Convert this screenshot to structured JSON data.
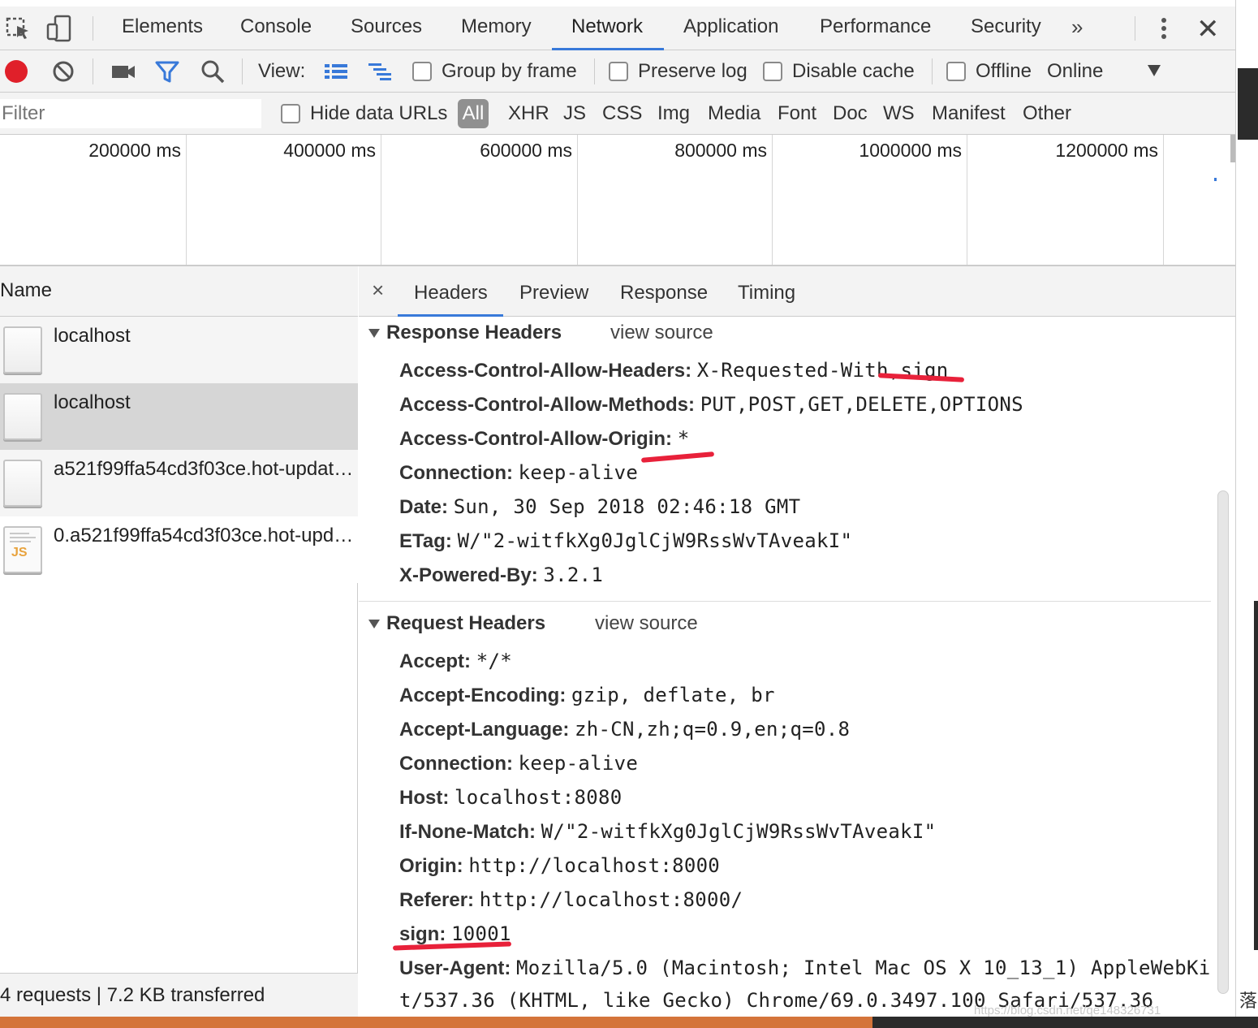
{
  "tabs": [
    "Elements",
    "Console",
    "Sources",
    "Memory",
    "Network",
    "Application",
    "Performance",
    "Security"
  ],
  "active_tab": "Network",
  "overflow_label": "»",
  "toolbar": {
    "view_label": "View:",
    "group_by_frame": "Group by frame",
    "preserve_log": "Preserve log",
    "disable_cache": "Disable cache",
    "offline": "Offline",
    "throttle": "Online"
  },
  "filter": {
    "placeholder": "Filter",
    "hide_data_urls": "Hide data URLs",
    "types": [
      "All",
      "XHR",
      "JS",
      "CSS",
      "Img",
      "Media",
      "Font",
      "Doc",
      "WS",
      "Manifest",
      "Other"
    ],
    "active_type": "All"
  },
  "timeline": {
    "ticks": [
      "200000 ms",
      "400000 ms",
      "600000 ms",
      "800000 ms",
      "1000000 ms",
      "1200000 ms"
    ]
  },
  "request_list": {
    "column_header": "Name",
    "rows": [
      {
        "name": "localhost",
        "icon": "document-icon"
      },
      {
        "name": "localhost",
        "icon": "document-icon"
      },
      {
        "name": "a521f99ffa54cd3f03ce.hot-update.json",
        "icon": "document-icon"
      },
      {
        "name": "0.a521f99ffa54cd3f03ce.hot-update.js",
        "icon": "js-file-icon",
        "icon_label": "JS"
      }
    ],
    "summary": "4 requests | 7.2 KB transferred"
  },
  "details": {
    "close_glyph": "×",
    "tabs": [
      "Headers",
      "Preview",
      "Response",
      "Timing"
    ],
    "active_tab": "Headers",
    "response_headers": {
      "title": "Response Headers",
      "view_source": "view source",
      "items": [
        {
          "key": "Access-Control-Allow-Headers:",
          "value": "X-Requested-With,sign"
        },
        {
          "key": "Access-Control-Allow-Methods:",
          "value": "PUT,POST,GET,DELETE,OPTIONS"
        },
        {
          "key": "Access-Control-Allow-Origin:",
          "value": "*"
        },
        {
          "key": "Connection:",
          "value": "keep-alive"
        },
        {
          "key": "Date:",
          "value": "Sun, 30 Sep 2018 02:46:18 GMT"
        },
        {
          "key": "ETag:",
          "value": "W/\"2-witfkXg0JglCjW9RssWvTAveakI\""
        },
        {
          "key": "X-Powered-By:",
          "value": "3.2.1"
        }
      ]
    },
    "request_headers": {
      "title": "Request Headers",
      "view_source": "view source",
      "items": [
        {
          "key": "Accept:",
          "value": "*/*"
        },
        {
          "key": "Accept-Encoding:",
          "value": "gzip, deflate, br"
        },
        {
          "key": "Accept-Language:",
          "value": "zh-CN,zh;q=0.9,en;q=0.8"
        },
        {
          "key": "Connection:",
          "value": "keep-alive"
        },
        {
          "key": "Host:",
          "value": "localhost:8080"
        },
        {
          "key": "If-None-Match:",
          "value": "W/\"2-witfkXg0JglCjW9RssWvTAveakI\""
        },
        {
          "key": "Origin:",
          "value": "http://localhost:8000"
        },
        {
          "key": "Referer:",
          "value": "http://localhost:8000/"
        },
        {
          "key": "sign:",
          "value": "10001"
        },
        {
          "key": "User-Agent:",
          "value": "Mozilla/5.0 (Macintosh; Intel Mac OS X 10_13_1) AppleWebKi"
        }
      ],
      "user_agent_continued": "t/537.36 (KHTML, like Gecko) Chrome/69.0.3497.100 Safari/537.36"
    }
  },
  "watermark": "https://blog.csdn.net/qe148326731",
  "colors": {
    "accent": "#3879d9",
    "record": "#e0202a",
    "annotation": "#e8213a",
    "taskbar": "#d4743a"
  }
}
